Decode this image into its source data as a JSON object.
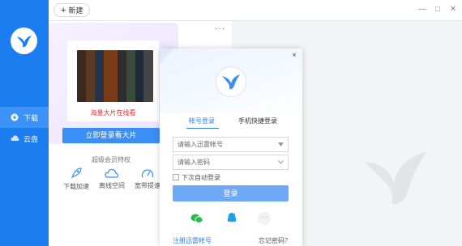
{
  "toolbar": {
    "new_label": "新建",
    "minimize": "—",
    "maximize": "□",
    "close": "✕"
  },
  "sidebar": {
    "items": [
      {
        "label": "下载",
        "icon": "download-icon",
        "active": true
      },
      {
        "label": "云盘",
        "icon": "cloud-icon",
        "active": false
      }
    ]
  },
  "promo": {
    "caption": "海量大片在线看",
    "button_label": "立即登录看大片",
    "perk_title": "超级会员特权",
    "perks": [
      {
        "label": "下载加速",
        "icon": "rocket-icon"
      },
      {
        "label": "离线空间",
        "icon": "cloud-icon"
      },
      {
        "label": "宽带提速",
        "icon": "speedometer-icon"
      }
    ],
    "more_label": "···"
  },
  "login": {
    "close_label": "×",
    "tabs": [
      {
        "label": "帐号登录",
        "active": true
      },
      {
        "label": "手机快捷登录",
        "active": false
      }
    ],
    "username_placeholder": "请输入迅雷帐号",
    "password_placeholder": "请输入密码",
    "auto_login_label": "下次自动登录",
    "submit_label": "登录",
    "social": [
      "wechat-icon",
      "qq-icon",
      "more-icon"
    ],
    "more_label": "···",
    "register_label": "注册迅雷帐号",
    "forgot_label": "忘记密码？"
  },
  "colors": {
    "sidebar_bg": "#1c7df0",
    "accent": "#3a8ff5",
    "login_button": "#6da9f6",
    "promo_caption": "#e03030"
  }
}
